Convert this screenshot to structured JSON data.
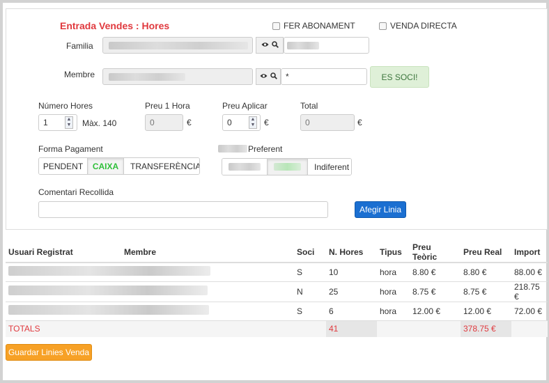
{
  "form": {
    "title": "Entrada Vendes : Hores",
    "fer_abonament": "FER ABONAMENT",
    "venda_directa": "VENDA DIRECTA",
    "familia_label": "Familia",
    "membre_label": "Membre",
    "membre_search_value": "*",
    "es_soci": "ES SOCI!",
    "numero_hores_label": "Número Hores",
    "numero_hores_value": "1",
    "max_label": "Màx. 140",
    "preu_hora_label": "Preu 1 Hora",
    "preu_hora_value": "0",
    "preu_aplicar_label": "Preu Aplicar",
    "preu_aplicar_value": "0",
    "total_label": "Total",
    "total_value": "0",
    "euro": "€",
    "forma_pagament_label": "Forma Pagament",
    "pagament_options": [
      "PENDENT",
      "CAIXA",
      "TRANSFERÈNCIA"
    ],
    "pagament_selected": "CAIXA",
    "preferent_label": "Preferent",
    "preferent_last": "Indiferent",
    "comentari_label": "Comentari Recollida",
    "comentari_value": "",
    "afegir_button": "Afegir Linia"
  },
  "table": {
    "headers": [
      "Usuari Registrat",
      "Membre",
      "Soci",
      "N. Hores",
      "Tipus",
      "Preu Teòric",
      "Preu Real",
      "Import"
    ],
    "rows": [
      {
        "soci": "S",
        "hores": "10",
        "tipus": "hora",
        "teoric": "8.80 €",
        "real": "8.80 €",
        "import": "88.00 €"
      },
      {
        "soci": "N",
        "hores": "25",
        "tipus": "hora",
        "teoric": "8.75 €",
        "real": "8.75 €",
        "import": "218.75 €"
      },
      {
        "soci": "S",
        "hores": "6",
        "tipus": "hora",
        "teoric": "12.00 €",
        "real": "12.00 €",
        "import": "72.00 €"
      }
    ],
    "totals_label": "TOTALS",
    "totals_hores": "41",
    "totals_real": "378.75 €"
  },
  "guardar_button": "Guardar Linies Venda",
  "colors": {
    "accent_red": "#e0393e",
    "primary_blue": "#1b6fd1",
    "orange": "#f7a126",
    "success_green": "#2fbf3a"
  },
  "icons": [
    "eye-icon",
    "search-icon",
    "checkbox-icon",
    "spinner-arrows-icon"
  ]
}
